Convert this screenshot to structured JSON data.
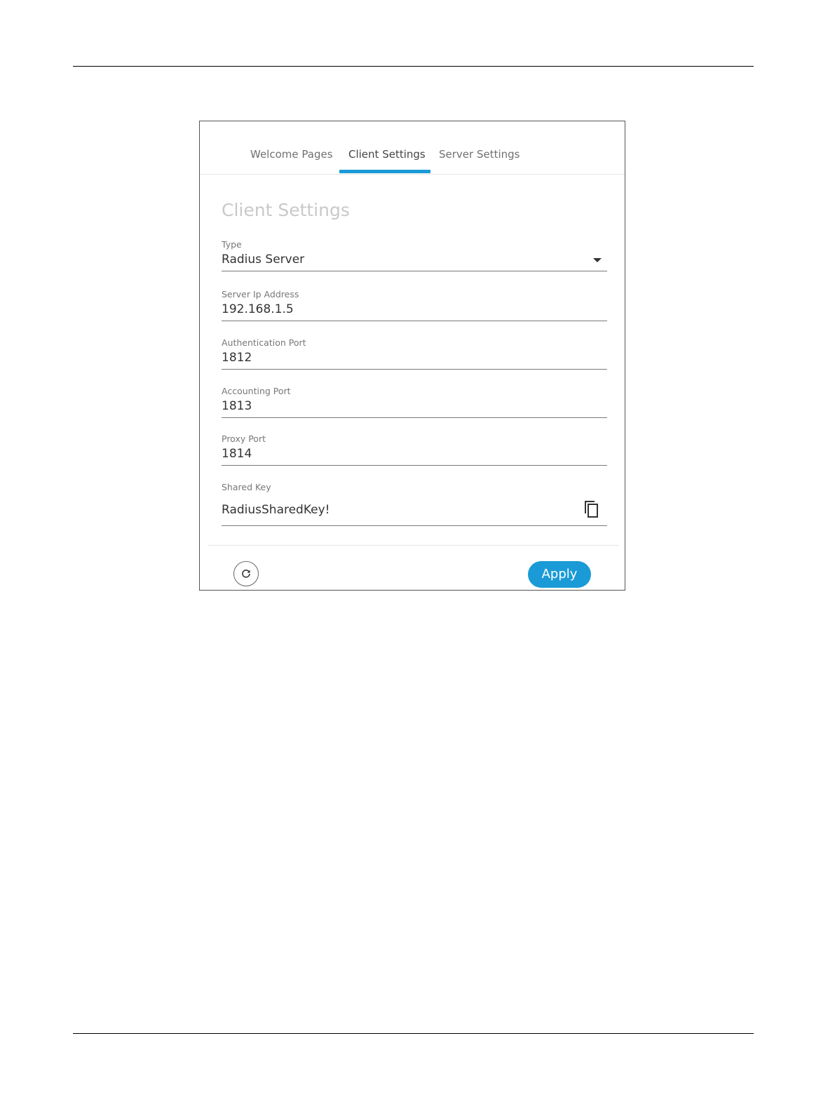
{
  "tabs": {
    "welcome_label": "Welcome Pages",
    "client_label": "Client Settings",
    "server_label": "Server Settings",
    "active": "Client Settings"
  },
  "section": {
    "title": "Client Settings"
  },
  "fields": {
    "type": {
      "label": "Type",
      "value": "Radius Server"
    },
    "server_ip": {
      "label": "Server Ip Address",
      "value": "192.168.1.5"
    },
    "auth_port": {
      "label": "Authentication Port",
      "value": "1812"
    },
    "acct_port": {
      "label": "Accounting Port",
      "value": "1813"
    },
    "proxy_port": {
      "label": "Proxy Port",
      "value": "1814"
    },
    "shared_key": {
      "label": "Shared Key",
      "value": "RadiusSharedKey!"
    }
  },
  "footer": {
    "apply_label": "Apply"
  },
  "icons": {
    "dropdown": "chevron-down-icon",
    "copy": "copy-icon",
    "reset": "refresh-icon"
  },
  "colors": {
    "accent": "#1a9bd7"
  }
}
